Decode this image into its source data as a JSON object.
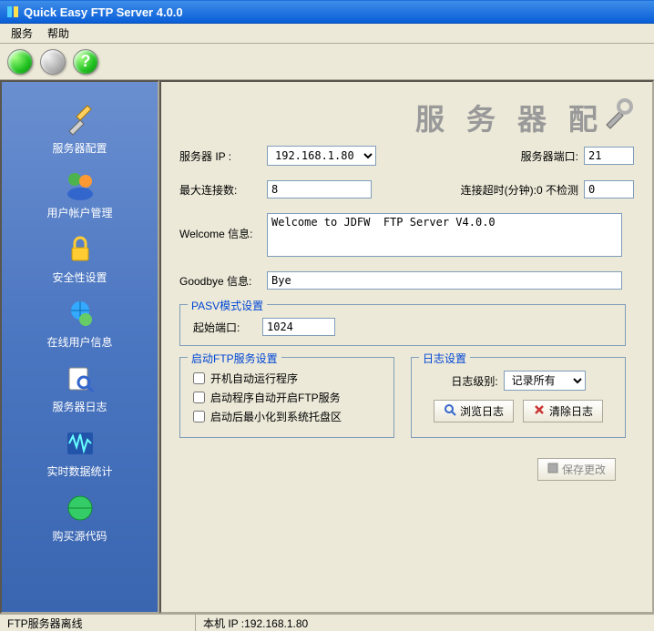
{
  "title": "Quick Easy FTP Server 4.0.0",
  "menu": {
    "service": "服务",
    "help": "帮助"
  },
  "toolbar": {
    "help_glyph": "?"
  },
  "sidebar": {
    "items": [
      {
        "label": "服务器配置",
        "icon": "wrench-screwdriver"
      },
      {
        "label": "用户帐户管理",
        "icon": "users"
      },
      {
        "label": "安全性设置",
        "icon": "lock"
      },
      {
        "label": "在线用户信息",
        "icon": "globe-user"
      },
      {
        "label": "服务器日志",
        "icon": "magnifier"
      },
      {
        "label": "实时数据统计",
        "icon": "waveform"
      },
      {
        "label": "购买源代码",
        "icon": "globe"
      }
    ]
  },
  "banner": "服 务 器 配",
  "form": {
    "server_ip_label": "服务器 IP :",
    "server_ip": "192.168.1.80",
    "server_port_label": "服务器端口:",
    "server_port": "21",
    "max_conn_label": "最大连接数:",
    "max_conn": "8",
    "timeout_label": "连接超时(分钟):0 不检测",
    "timeout": "0",
    "welcome_label": "Welcome 信息:",
    "welcome": "Welcome to JDFW  FTP Server V4.0.0",
    "goodbye_label": "Goodbye 信息:",
    "goodbye": "Bye"
  },
  "pasv": {
    "legend": "PASV模式设置",
    "start_port_label": "起始端口:",
    "start_port": "1024"
  },
  "startup": {
    "legend": "启动FTP服务设置",
    "autorun": "开机自动运行程序",
    "autostart": "启动程序自动开启FTP服务",
    "minimize": "启动后最小化到系统托盘区"
  },
  "log": {
    "legend": "日志设置",
    "level_label": "日志级别:",
    "level_value": "记录所有",
    "browse": "浏览日志",
    "clear": "清除日志"
  },
  "save_btn": "保存更改",
  "status": {
    "server_state": "FTP服务器离线",
    "local_ip": "本机 IP :192.168.1.80"
  }
}
